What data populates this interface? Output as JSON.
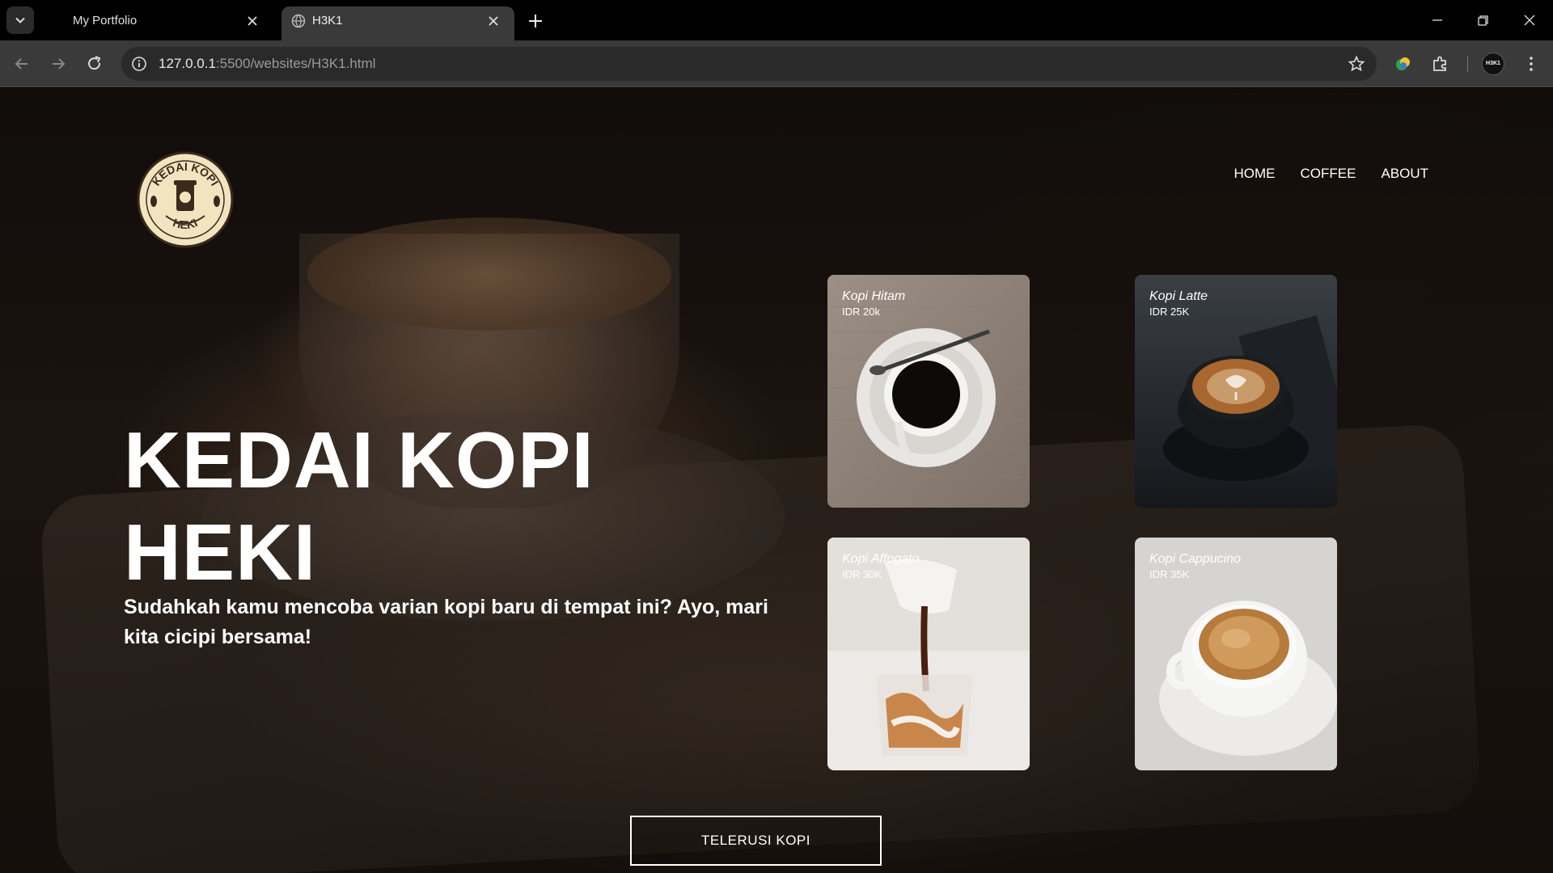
{
  "browser": {
    "tabs": [
      {
        "title": "My Portfolio",
        "active": false
      },
      {
        "title": "H3K1",
        "active": true
      }
    ],
    "url_host": "127.0.0.1",
    "url_rest": ":5500/websites/H3K1.html",
    "profile_label": "H3K1"
  },
  "site": {
    "logo_alt": "KEDAI KOPI HEKI",
    "nav": [
      "HOME",
      "COFFEE",
      "ABOUT"
    ],
    "hero_title_line1": "KEDAI KOPI",
    "hero_title_line2": "HEKI",
    "hero_subtitle": "Sudahkah kamu mencoba varian kopi baru di tempat ini? Ayo, mari kita cicipi bersama!",
    "menu": [
      {
        "name": "Kopi Hitam",
        "price": "IDR 20k"
      },
      {
        "name": "Kopi Latte",
        "price": "IDR 25K"
      },
      {
        "name": "Kopi Affogato",
        "price": "IDR 30K"
      },
      {
        "name": "Kopi Cappucino",
        "price": "IDR 35K"
      }
    ],
    "cta_label": "TELERUSI KOPI"
  },
  "colors": {
    "chrome_dark": "#000000",
    "chrome_toolbar": "#3a3a3a",
    "logo_cream": "#f3e4c0",
    "logo_brown": "#3b2a1c"
  }
}
